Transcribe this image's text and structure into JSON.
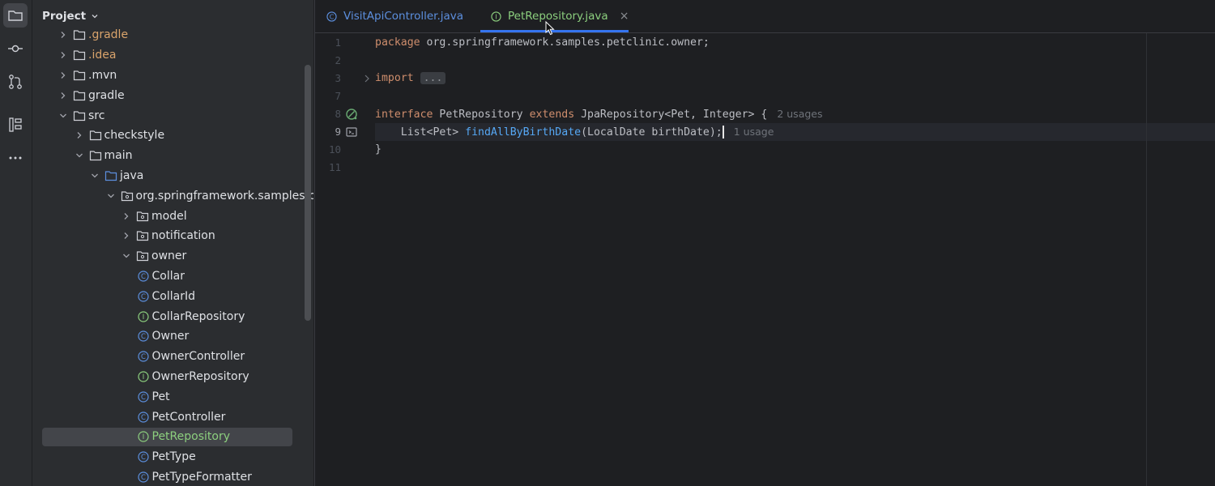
{
  "panel": {
    "title": "Project"
  },
  "tree": [
    {
      "label": ".gradle",
      "depth": 1,
      "type": "folder",
      "expanded": false,
      "color": "orange"
    },
    {
      "label": ".idea",
      "depth": 1,
      "type": "folder",
      "expanded": false,
      "color": "orange"
    },
    {
      "label": ".mvn",
      "depth": 1,
      "type": "folder",
      "expanded": false
    },
    {
      "label": "gradle",
      "depth": 1,
      "type": "folder",
      "expanded": false
    },
    {
      "label": "src",
      "depth": 1,
      "type": "folder",
      "expanded": true
    },
    {
      "label": "checkstyle",
      "depth": 2,
      "type": "folder",
      "expanded": false
    },
    {
      "label": "main",
      "depth": 2,
      "type": "folder",
      "expanded": true
    },
    {
      "label": "java",
      "depth": 3,
      "type": "source-folder",
      "expanded": true
    },
    {
      "label": "org.springframework.samples.pe",
      "depth": 4,
      "type": "package",
      "expanded": true
    },
    {
      "label": "model",
      "depth": 5,
      "type": "package",
      "expanded": false
    },
    {
      "label": "notification",
      "depth": 5,
      "type": "package",
      "expanded": false
    },
    {
      "label": "owner",
      "depth": 5,
      "type": "package",
      "expanded": true
    },
    {
      "label": "Collar",
      "depth": 6,
      "type": "class"
    },
    {
      "label": "CollarId",
      "depth": 6,
      "type": "class"
    },
    {
      "label": "CollarRepository",
      "depth": 6,
      "type": "interface"
    },
    {
      "label": "Owner",
      "depth": 6,
      "type": "class"
    },
    {
      "label": "OwnerController",
      "depth": 6,
      "type": "class"
    },
    {
      "label": "OwnerRepository",
      "depth": 6,
      "type": "interface"
    },
    {
      "label": "Pet",
      "depth": 6,
      "type": "class"
    },
    {
      "label": "PetController",
      "depth": 6,
      "type": "class"
    },
    {
      "label": "PetRepository",
      "depth": 6,
      "type": "interface",
      "selected": true
    },
    {
      "label": "PetType",
      "depth": 6,
      "type": "class"
    },
    {
      "label": "PetTypeFormatter",
      "depth": 6,
      "type": "class"
    }
  ],
  "tabs": [
    {
      "label": "VisitApiController.java",
      "icon": "class-icon",
      "active": false
    },
    {
      "label": "PetRepository.java",
      "icon": "interface-icon",
      "active": true,
      "close": "×"
    }
  ],
  "code": {
    "line_numbers": [
      "1",
      "2",
      "3",
      "7",
      "8",
      "9",
      "10",
      "11"
    ],
    "l1_kw": "package",
    "l1_rest": " org.springframework.samples.petclinic.owner;",
    "l3_kw": "import",
    "l3_fold": "...",
    "l8_kw1": "interface",
    "l8_a": " PetRepository ",
    "l8_kw2": "extends",
    "l8_b": " JpaRepository<Pet, Integer> {",
    "l8_hint": "2 usages",
    "l9_a": "    List<Pet> ",
    "l9_fn": "findAllByBirthDate",
    "l9_b": "(LocalDate birthDate);",
    "l9_hint": "1 usage",
    "l10": "}"
  },
  "colors": {
    "accent": "#3574f0",
    "interface": "#8ccf7e",
    "class": "#5c8fde",
    "keyword": "#cf8e6d",
    "method": "#56a8f5"
  }
}
